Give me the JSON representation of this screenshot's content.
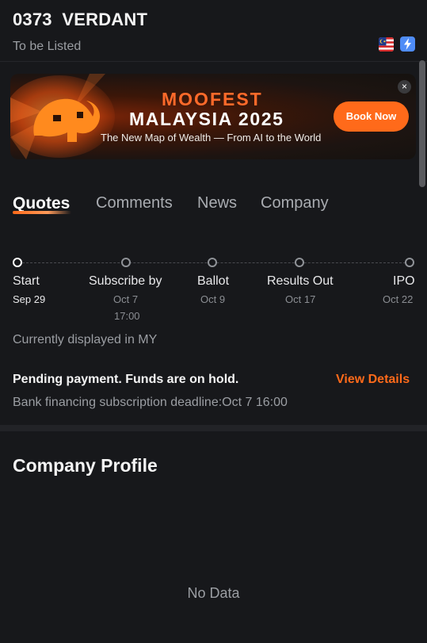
{
  "header": {
    "code": "0373",
    "name": "VERDANT",
    "status": "To be Listed"
  },
  "banner": {
    "brand": "MOOFEST",
    "headline": "MALAYSIA 2025",
    "tagline": "The New Map of Wealth — From AI to the World",
    "cta": "Book Now",
    "close": "×"
  },
  "tabs": [
    {
      "label": "Quotes"
    },
    {
      "label": "Comments"
    },
    {
      "label": "News"
    },
    {
      "label": "Company"
    }
  ],
  "timeline": [
    {
      "label": "Start",
      "date": "Sep 29",
      "time": ""
    },
    {
      "label": "Subscribe by",
      "date": "Oct 7",
      "time": "17:00"
    },
    {
      "label": "Ballot",
      "date": "Oct 9",
      "time": ""
    },
    {
      "label": "Results Out",
      "date": "Oct 17",
      "time": ""
    },
    {
      "label": "IPO",
      "date": "Oct 22",
      "time": ""
    }
  ],
  "market_note": "Currently displayed in MY",
  "pending": {
    "title": "Pending payment. Funds are on hold.",
    "link": "View Details",
    "note": "Bank financing subscription deadline:Oct 7 16:00"
  },
  "profile": {
    "title": "Company Profile",
    "empty": "No Data"
  },
  "colors": {
    "accent": "#ff6a1a",
    "background": "#17181b"
  },
  "icons": {
    "flag": "malaysia-flag-icon",
    "flash": "lightning-icon"
  }
}
